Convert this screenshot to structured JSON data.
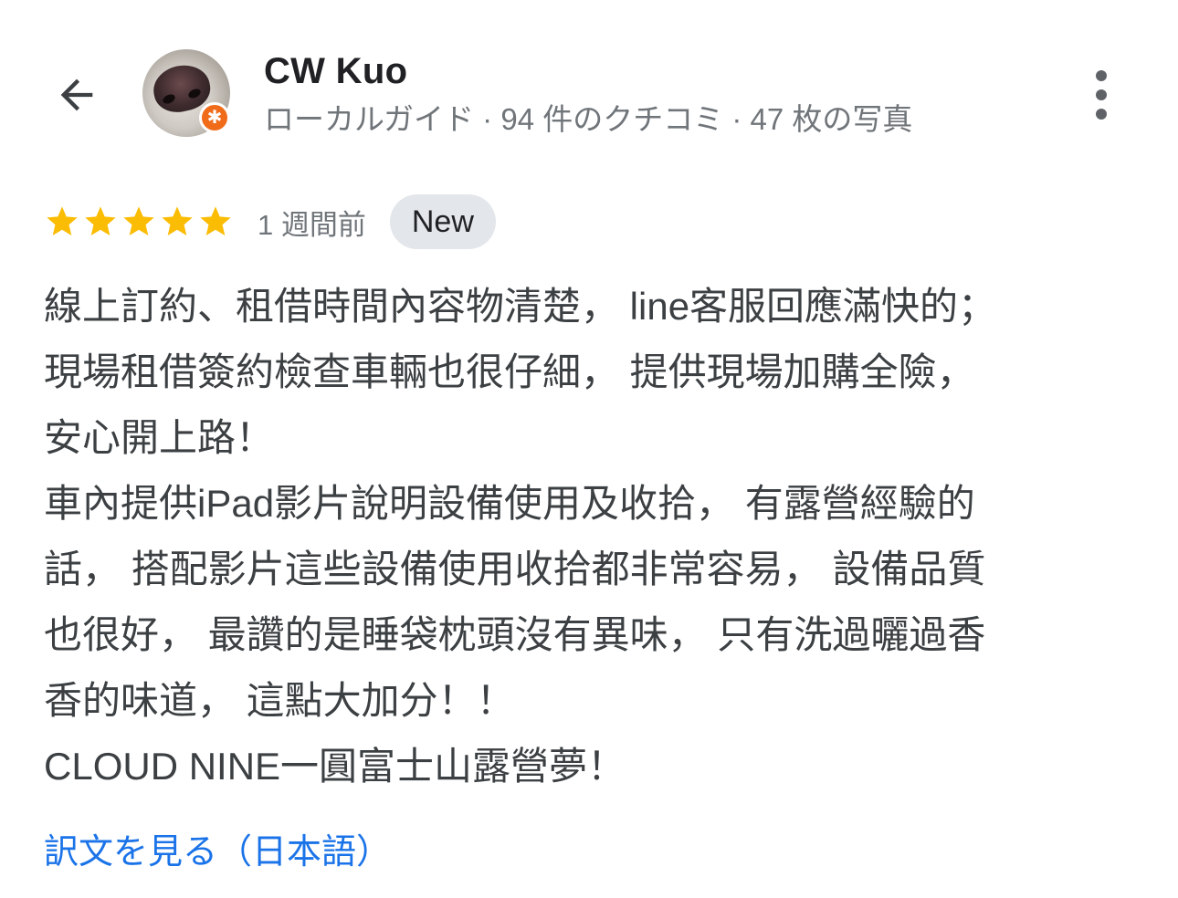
{
  "header": {
    "back_icon": "arrow-left-icon",
    "user_name": "CW Kuo",
    "user_meta": "ローカルガイド · 94 件のクチコミ · 47 枚の写真",
    "more_icon": "more-vert-icon",
    "badge_icon": "local-guide-star-icon",
    "badge_color": "#f06c1b"
  },
  "review": {
    "rating": 5,
    "rating_max": 5,
    "star_color": "#fbbc04",
    "time": "1 週間前",
    "new_label": "New",
    "text_lines": [
      "線上訂約、租借時間內容物清楚， line客服回應滿快的；",
      "現場租借簽約檢查車輛也很仔細， 提供現場加購全險，",
      "安心開上路！",
      "車內提供iPad影片說明設備使用及收拾， 有露營經驗的",
      "話， 搭配影片這些設備使用收拾都非常容易， 設備品質",
      "也很好， 最讚的是睡袋枕頭沒有異味， 只有洗過曬過香",
      "香的味道， 這點大加分！！",
      "CLOUD NINE一圓富士山露營夢！"
    ],
    "translate_label": "訳文を見る（日本語）",
    "link_color": "#1a73e8"
  }
}
